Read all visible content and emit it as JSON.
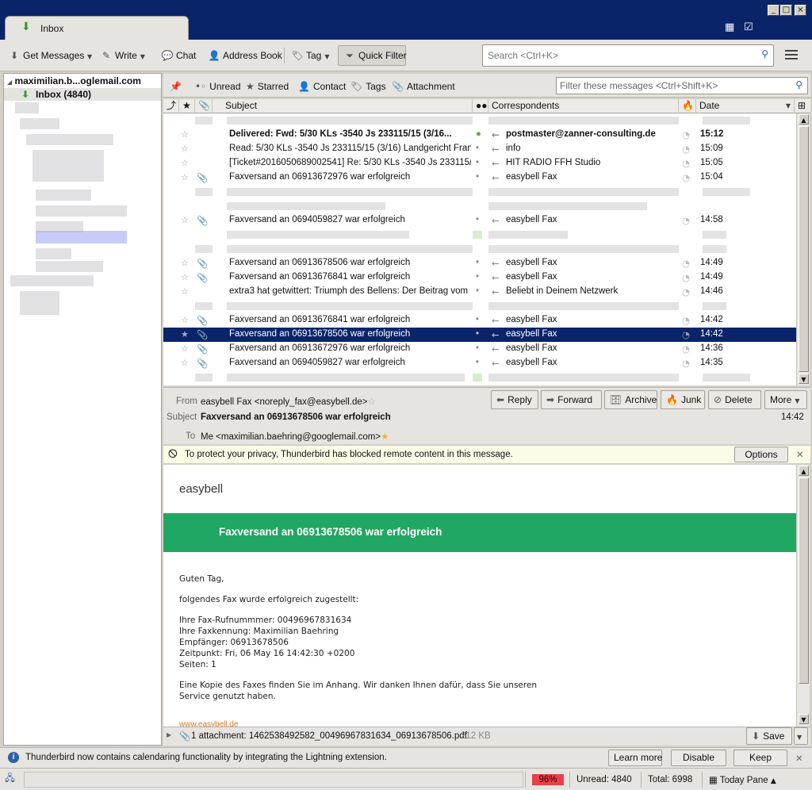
{
  "window": {
    "tab_label": "Inbox"
  },
  "toolbar": {
    "get_messages": "Get Messages",
    "write": "Write",
    "chat": "Chat",
    "address_book": "Address Book",
    "tag": "Tag",
    "quick_filter": "Quick Filter",
    "search_placeholder": "Search <Ctrl+K>"
  },
  "folders": {
    "account": "maximilian.b...oglemail.com",
    "inbox": "Inbox (4840)"
  },
  "filterbar": {
    "unread": "Unread",
    "starred": "Starred",
    "contact": "Contact",
    "tags": "Tags",
    "attachment": "Attachment",
    "placeholder": "Filter these messages <Ctrl+Shift+K>"
  },
  "columns": {
    "subject": "Subject",
    "correspondents": "Correspondents",
    "date": "Date"
  },
  "messages": [
    {
      "subject": "Delivered: Fwd: 5/30 KLs -3540 Js 233115/15 (3/16...",
      "from": "postmaster@zanner-consulting.de",
      "date": "15:12",
      "bold": true,
      "att": false
    },
    {
      "subject": "Read: 5/30 KLs -3540 Js 233115/15 (3/16) Landgericht Fran...",
      "from": "info",
      "date": "15:09",
      "bold": false,
      "att": false
    },
    {
      "subject": "[Ticket#2016050689002541] Re: 5/30 KLs -3540 Js 233115/...",
      "from": "HIT RADIO FFH Studio",
      "date": "15:05",
      "bold": false,
      "att": false
    },
    {
      "subject": "Faxversand an 06913672976 war erfolgreich",
      "from": "easybell Fax",
      "date": "15:04",
      "bold": false,
      "att": true
    },
    {
      "subject": "Faxversand an 0694059827 war erfolgreich",
      "from": "easybell Fax",
      "date": "14:58",
      "bold": false,
      "att": true
    },
    {
      "subject": "Faxversand an 06913678506 war erfolgreich",
      "from": "easybell Fax",
      "date": "14:49",
      "bold": false,
      "att": true
    },
    {
      "subject": "Faxversand an 06913676841 war erfolgreich",
      "from": "easybell Fax",
      "date": "14:49",
      "bold": false,
      "att": true
    },
    {
      "subject": "extra3 hat getwittert: Triumph des Bellens: Der Beitrag vom ...",
      "from": "Beliebt in Deinem Netzwerk",
      "date": "14:46",
      "bold": false,
      "att": false
    },
    {
      "subject": "Faxversand an 06913676841 war erfolgreich",
      "from": "easybell Fax",
      "date": "14:42",
      "bold": false,
      "att": true
    },
    {
      "subject": "Faxversand an 06913678506 war erfolgreich",
      "from": "easybell Fax",
      "date": "14:42",
      "bold": false,
      "att": true,
      "selected": true
    },
    {
      "subject": "Faxversand an 06913672976 war erfolgreich",
      "from": "easybell Fax",
      "date": "14:36",
      "bold": false,
      "att": true
    },
    {
      "subject": "Faxversand an 0694059827 war erfolgreich",
      "from": "easybell Fax",
      "date": "14:35",
      "bold": false,
      "att": true
    }
  ],
  "header": {
    "from_label": "From",
    "from": "easybell Fax <noreply_fax@easybell.de>",
    "subject_label": "Subject",
    "subject": "Faxversand an 06913678506 war erfolgreich",
    "to_label": "To",
    "to": "Me <maximilian.baehring@googlemail.com>",
    "time": "14:42",
    "reply": "Reply",
    "forward": "Forward",
    "archive": "Archive",
    "junk": "Junk",
    "delete": "Delete",
    "more": "More"
  },
  "notice": {
    "text": "To protect your privacy, Thunderbird has blocked remote content in this message.",
    "options": "Options"
  },
  "email": {
    "brand": "easybell",
    "banner": "Faxversand an 06913678506 war erfolgreich",
    "greeting": "Guten Tag,",
    "intro": "folgendes Fax wurde erfolgreich zugestellt:",
    "line1": "Ihre Fax-Rufnummmer: 00496967831634",
    "line2": "Ihre Faxkennung: Maximilian Baehring",
    "line3": "Empfänger: 06913678506",
    "line4": "Zeitpunkt: Fri, 06 May 16 14:42:30 +0200",
    "line5": "Seiten: 1",
    "closing1": "Eine Kopie des Faxes finden Sie im Anhang. Wir danken Ihnen dafür, dass Sie unseren",
    "closing2": "Service genutzt haben.",
    "link": "www.easybell.de"
  },
  "attachment": {
    "label": "1 attachment: 1462538492582_00496967831634_06913678506.pdf",
    "size": "212 KB",
    "save": "Save"
  },
  "lightning": {
    "text": "Thunderbird now contains calendaring functionality by integrating the Lightning extension.",
    "learn_more": "Learn more",
    "disable": "Disable",
    "keep": "Keep"
  },
  "status": {
    "progress": "96%",
    "unread": "Unread: 4840",
    "total": "Total: 6998",
    "today_pane": "Today Pane"
  }
}
